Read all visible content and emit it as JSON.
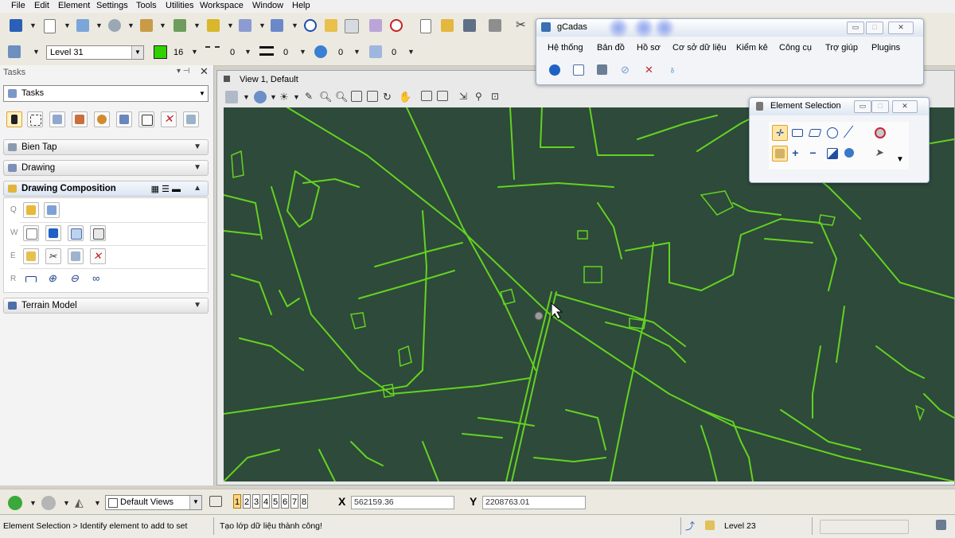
{
  "menu": [
    "File",
    "Edit",
    "Element",
    "Settings",
    "Tools",
    "Utilities",
    "Workspace",
    "Window",
    "Help"
  ],
  "attr_toolbar": {
    "level": "Level 31",
    "color_value": "16",
    "style_value": "0",
    "weight_value": "0",
    "transparency_value": "0",
    "priority_value": "0"
  },
  "tasks_panel": {
    "header": "Tasks",
    "dropdown": "Tasks",
    "sections": [
      "Bien Tap",
      "Drawing",
      "Drawing Composition",
      "Terrain Model"
    ],
    "row_labels": [
      "Q",
      "W",
      "E",
      "R"
    ]
  },
  "view": {
    "title": "View 1, Default"
  },
  "gcadas": {
    "title": "gCadas",
    "menu": [
      "Hệ thống",
      "Bản đồ",
      "Hồ sơ",
      "Cơ sở dữ liệu",
      "Kiểm kê",
      "Công cụ",
      "Trợ giúp",
      "Plugins"
    ]
  },
  "element_selection": {
    "title": "Element Selection"
  },
  "bottom_bar": {
    "views_combo": "Default Views",
    "view_numbers": [
      "1",
      "2",
      "3",
      "4",
      "5",
      "6",
      "7",
      "8"
    ],
    "x_label": "X",
    "x_value": "562159.36",
    "y_label": "Y",
    "y_value": "2208763.01"
  },
  "status": {
    "prompt": "Element Selection > Identify element to add to set",
    "message": "Tạo lớp dữ liệu thành công!",
    "level": "Level 23"
  },
  "colors": {
    "canvas": "#2e4a3a",
    "lines": "#62d321",
    "active_color_swatch": "#31d100"
  }
}
